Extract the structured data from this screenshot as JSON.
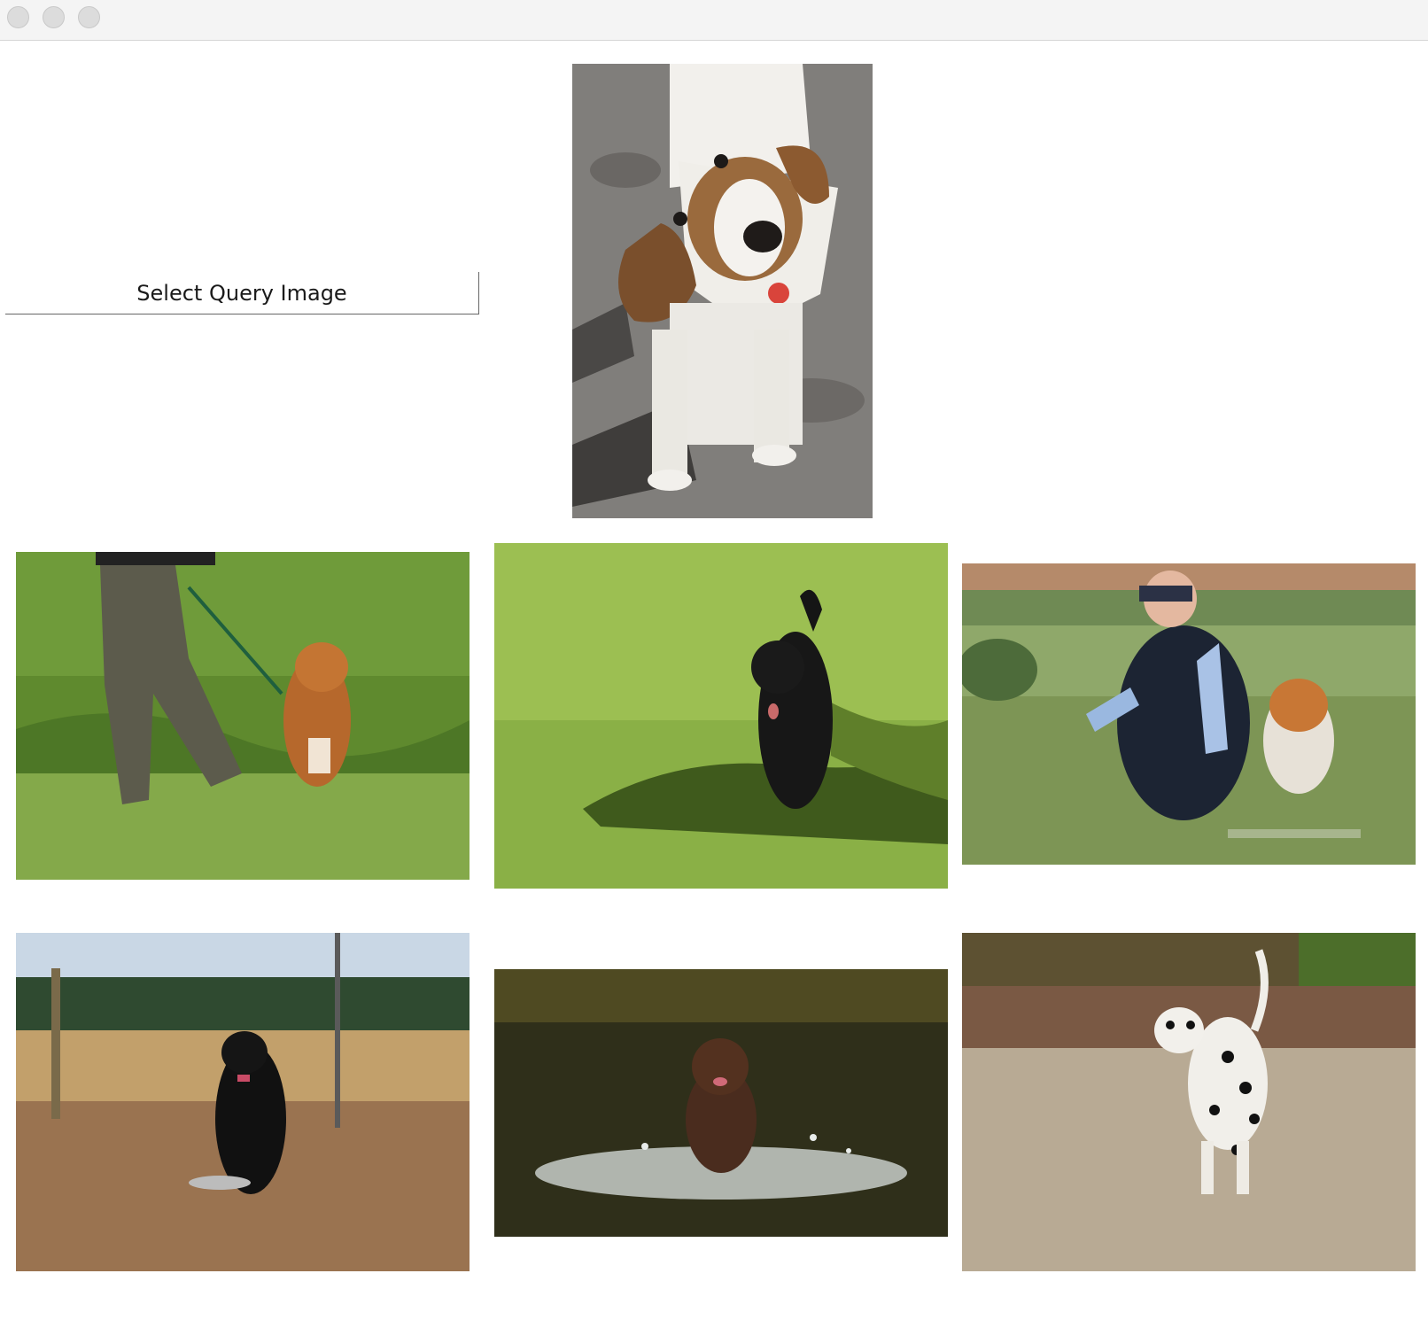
{
  "window": {
    "traffic_lights": [
      "close",
      "minimize",
      "zoom"
    ]
  },
  "query": {
    "button_label": "Select Query Image",
    "image_subject": "beagle on sand"
  },
  "results": [
    {
      "subject": "nova scotia duck tolling retriever in grass with person"
    },
    {
      "subject": "black kerry blue terrier on lawn"
    },
    {
      "subject": "woman with duck tolling retriever in meadow"
    },
    {
      "subject": "black flat-coated retriever sitting on dirt"
    },
    {
      "subject": "brown irish water spaniel in river"
    },
    {
      "subject": "dalmatian on path"
    }
  ],
  "colors": {
    "titlebar": "#f4f4f4",
    "background": "#ffffff"
  }
}
